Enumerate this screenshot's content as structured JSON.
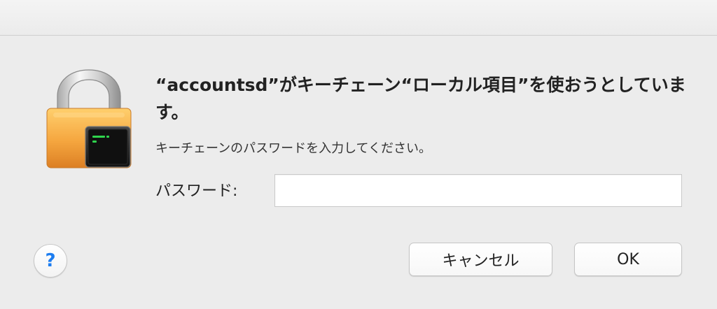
{
  "dialog": {
    "title_line": "“accountsd”がキーチェーン“ローカル項目”を使おうとしています。",
    "subtitle": "キーチェーンのパスワードを入力してください。",
    "password_label": "パスワード:",
    "password_value": "",
    "help_label": "?",
    "cancel_label": "キャンセル",
    "ok_label": "OK"
  },
  "icons": {
    "lock": "lock-icon",
    "help": "help-icon"
  },
  "colors": {
    "background": "#ececec",
    "lock_body": "#f3a43b",
    "lock_shackle": "#d9d9d9",
    "help_text": "#1d7df0",
    "input_border": "#c9c9c9"
  }
}
